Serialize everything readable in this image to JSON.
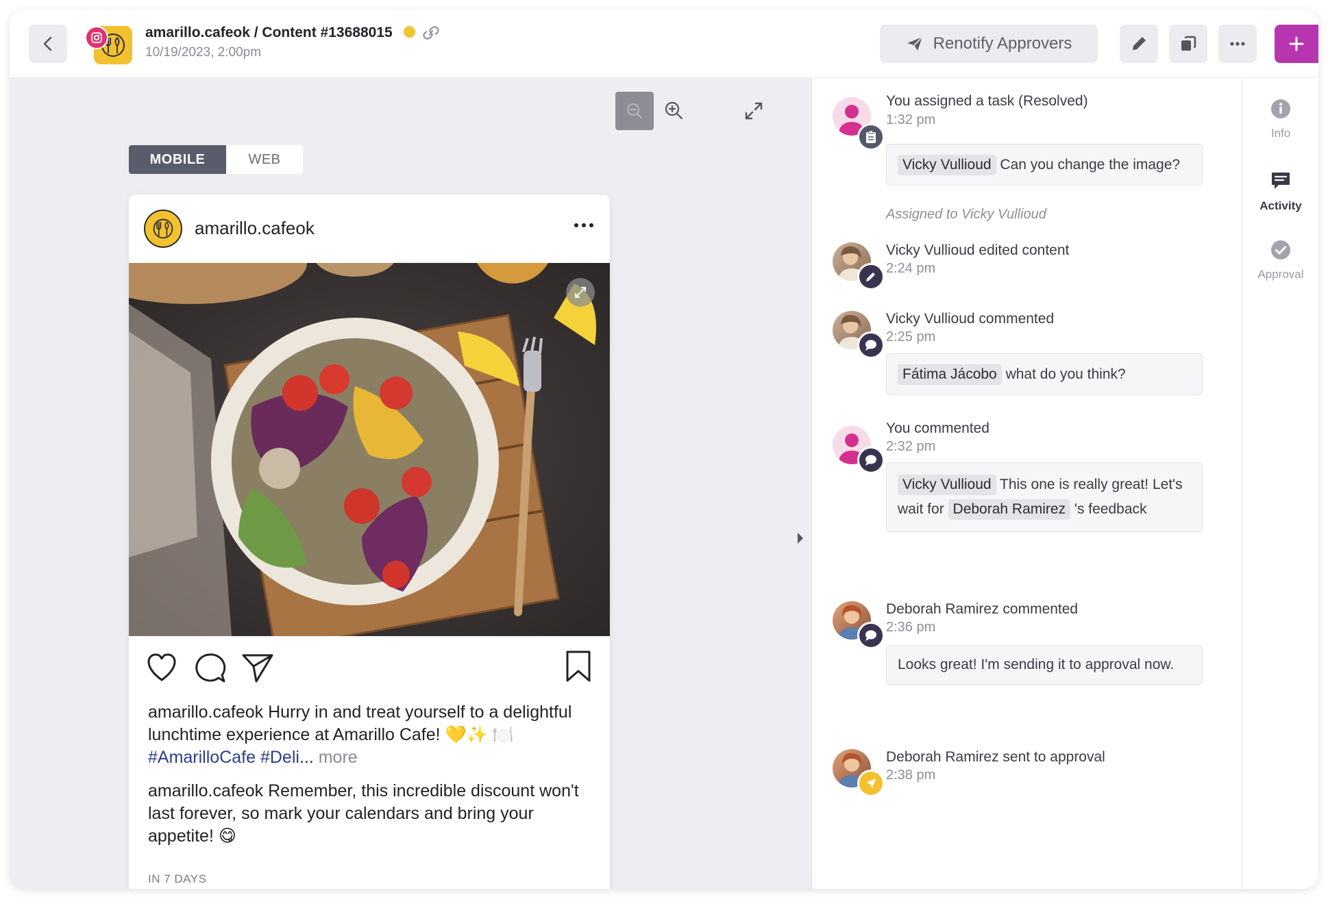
{
  "header": {
    "title": "amarillo.cafeok / Content #13688015",
    "date": "10/19/2023, 2:00pm",
    "renotify_label": "Renotify Approvers",
    "status_color": "#f0c432",
    "brand_color": "#b736b0"
  },
  "preview": {
    "tabs": [
      {
        "label": "MOBILE",
        "active": true
      },
      {
        "label": "WEB",
        "active": false
      }
    ]
  },
  "post": {
    "username": "amarillo.cafeok",
    "caption1": {
      "user": "amarillo.cafeok",
      "text": " Hurry in and treat yourself to a delightful lunchtime experience at Amarillo Cafe! 💛✨ 🍽️ ",
      "tags": "#AmarilloCafe #Deli",
      "ellipsis": "...",
      "more": " more"
    },
    "caption2": {
      "user": "amarillo.cafeok",
      "text": " Remember, this incredible discount won't last forever, so mark your calendars and bring your appetite! 😋"
    },
    "schedule": "IN 7 DAYS"
  },
  "feed": [
    {
      "title": "You assigned a task (Resolved)",
      "time": "1:32 pm",
      "mention": "Vicky Vullioud",
      "text": " Can you change the image?",
      "assigned": "Assigned to Vicky Vullioud"
    },
    {
      "title": "Vicky Vullioud edited content",
      "time": "2:24 pm"
    },
    {
      "title": "Vicky Vullioud commented",
      "time": "2:25 pm",
      "mention": "Fátima Jácobo",
      "text": " what do you think?"
    },
    {
      "title": "You commented",
      "time": "2:32 pm",
      "mention": "Vicky Vullioud",
      "text_a": " This one is really great! Let's wait for ",
      "mention2": "Deborah Ramirez",
      "text_b": " 's feedback"
    },
    {
      "title": "Deborah Ramirez commented",
      "time": "2:36 pm",
      "text": "Looks great! I'm sending it to approval now."
    },
    {
      "title": "Deborah Ramirez sent to approval",
      "time": "2:38 pm"
    }
  ],
  "side_tabs": [
    {
      "label": "Info",
      "icon": "info-icon"
    },
    {
      "label": "Activity",
      "icon": "comment-icon",
      "active": true
    },
    {
      "label": "Approval",
      "icon": "check-circle-icon"
    }
  ]
}
